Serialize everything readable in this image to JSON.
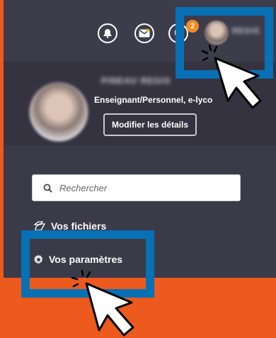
{
  "topbar": {
    "notification_count": "2",
    "user_name": "REGIS"
  },
  "profile": {
    "full_name": "PINEAU REGIS",
    "role": "Enseignant/Personnel, e-lyco",
    "edit_button": "Modifier les détails"
  },
  "search": {
    "placeholder": "Rechercher"
  },
  "nav": {
    "files_label": "Vos fichiers",
    "settings_label": "Vos paramètres"
  },
  "colors": {
    "background": "#ec5a1d",
    "panel": "#3b3a48",
    "highlight": "#0870b5",
    "badge": "#f28c1f"
  }
}
